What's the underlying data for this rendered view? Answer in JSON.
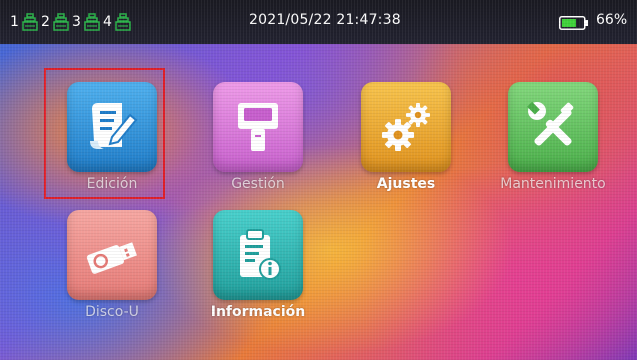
{
  "status_bar": {
    "channels": [
      {
        "number": "1",
        "icon": "ink-cartridge-icon"
      },
      {
        "number": "2",
        "icon": "ink-cartridge-icon"
      },
      {
        "number": "3",
        "icon": "ink-cartridge-icon"
      },
      {
        "number": "4",
        "icon": "ink-cartridge-icon"
      }
    ],
    "datetime": "2021/05/22 21:47:38",
    "battery_level": 0.66,
    "battery_text": "66%",
    "colors": {
      "ink_icon": "#2bb34a",
      "battery_fill": "#3fd23a"
    }
  },
  "apps": [
    {
      "label": "Edición",
      "icon": "document-edit-icon",
      "color": "#2a8fd8",
      "selected": true
    },
    {
      "label": "Gestión",
      "icon": "handheld-printer-icon",
      "color": "#d66fd8",
      "selected": false
    },
    {
      "label": "Ajustes",
      "icon": "gears-icon",
      "color": "#e9a52b",
      "selected": false
    },
    {
      "label": "Mantenimiento",
      "icon": "tools-icon",
      "color": "#5fc25e",
      "selected": false
    },
    {
      "label": "Disco-U",
      "icon": "usb-drive-icon",
      "color": "#ef8a86",
      "selected": false
    },
    {
      "label": "Información",
      "icon": "info-clipboard-icon",
      "color": "#2fb7b4",
      "selected": false
    }
  ],
  "selection_color": "#e0202a"
}
